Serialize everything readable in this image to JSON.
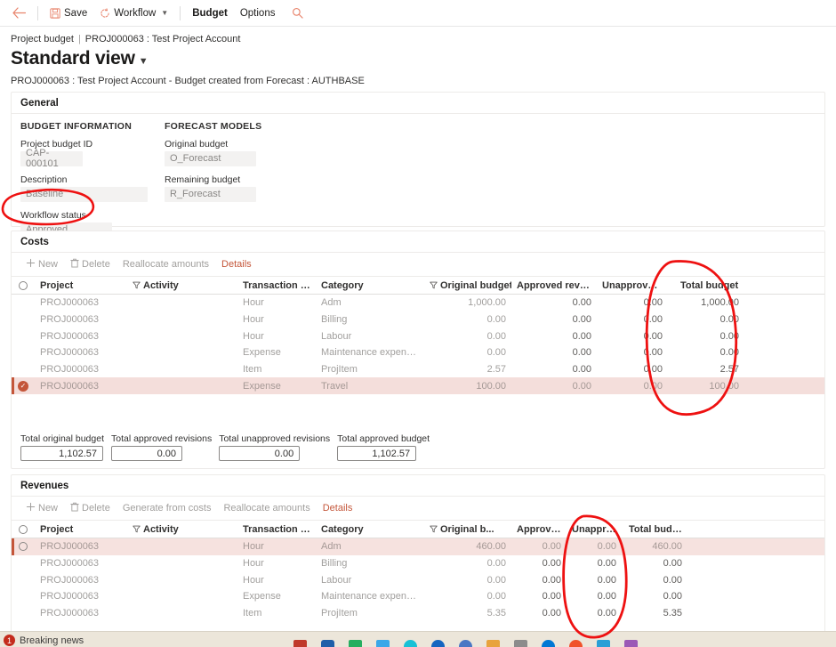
{
  "command_bar": {
    "back_icon": "back-arrow-icon",
    "items": [
      {
        "label": "Save",
        "icon": "save-disk-icon",
        "has_chevron": false,
        "bold": false
      },
      {
        "label": "Workflow",
        "icon": "workflow-circular-arrow-icon",
        "has_chevron": true,
        "bold": false
      },
      {
        "label": "Budget",
        "icon": "",
        "has_chevron": false,
        "bold": true
      },
      {
        "label": "Options",
        "icon": "",
        "has_chevron": false,
        "bold": false
      }
    ],
    "search_icon": "search-icon"
  },
  "breadcrumb": {
    "root": "Project budget",
    "separator": "|",
    "current": "PROJ000063 : Test Project Account"
  },
  "page_title": "Standard view",
  "subtitle": "PROJ000063 : Test Project Account - Budget created from Forecast : AUTHBASE",
  "general": {
    "section_title": "General",
    "budget_information": {
      "heading": "BUDGET INFORMATION",
      "fields": [
        {
          "label": "Project budget ID",
          "value": "CAP-000101"
        },
        {
          "label": "Description",
          "value": "Baseline"
        },
        {
          "label": "Workflow status",
          "value": "Approved"
        }
      ]
    },
    "forecast_models": {
      "heading": "FORECAST MODELS",
      "fields": [
        {
          "label": "Original budget",
          "value": "O_Forecast"
        },
        {
          "label": "Remaining budget",
          "value": "R_Forecast"
        }
      ]
    }
  },
  "costs": {
    "section_title": "Costs",
    "toolbar": [
      {
        "label": "New",
        "icon": "plus-icon",
        "enabled": false
      },
      {
        "label": "Delete",
        "icon": "trash-icon",
        "enabled": false
      },
      {
        "label": "Reallocate amounts",
        "icon": "",
        "enabled": false
      },
      {
        "label": "Details",
        "icon": "",
        "enabled": true
      }
    ],
    "columns": [
      "Project",
      "Activity",
      "Transaction type",
      "Category",
      "Original budget",
      "Approved revisions",
      "Unapproved re...",
      "Total budget"
    ],
    "rows": [
      {
        "selected": false,
        "project": "PROJ000063",
        "activity": "",
        "transaction_type": "Hour",
        "category": "Adm",
        "original_budget": "1,000.00",
        "approved_revisions": "0.00",
        "unapproved_revisions": "0.00",
        "total_budget": "1,000.00"
      },
      {
        "selected": false,
        "project": "PROJ000063",
        "activity": "",
        "transaction_type": "Hour",
        "category": "Billing",
        "original_budget": "0.00",
        "approved_revisions": "0.00",
        "unapproved_revisions": "0.00",
        "total_budget": "0.00"
      },
      {
        "selected": false,
        "project": "PROJ000063",
        "activity": "",
        "transaction_type": "Hour",
        "category": "Labour",
        "original_budget": "0.00",
        "approved_revisions": "0.00",
        "unapproved_revisions": "0.00",
        "total_budget": "0.00"
      },
      {
        "selected": false,
        "project": "PROJ000063",
        "activity": "",
        "transaction_type": "Expense",
        "category": "Maintenance expenses",
        "original_budget": "0.00",
        "approved_revisions": "0.00",
        "unapproved_revisions": "0.00",
        "total_budget": "0.00"
      },
      {
        "selected": false,
        "project": "PROJ000063",
        "activity": "",
        "transaction_type": "Item",
        "category": "ProjItem",
        "original_budget": "2.57",
        "approved_revisions": "0.00",
        "unapproved_revisions": "0.00",
        "total_budget": "2.57"
      },
      {
        "selected": true,
        "project": "PROJ000063",
        "activity": "",
        "transaction_type": "Expense",
        "category": "Travel",
        "original_budget": "100.00",
        "approved_revisions": "0.00",
        "unapproved_revisions": "0.00",
        "total_budget": "100.00"
      }
    ],
    "totals": [
      {
        "label": "Total original budget",
        "value": "1,102.57"
      },
      {
        "label": "Total approved revisions",
        "value": "0.00"
      },
      {
        "label": "Total unapproved revisions",
        "value": "0.00"
      },
      {
        "label": "Total approved budget",
        "value": "1,102.57"
      }
    ]
  },
  "revenues": {
    "section_title": "Revenues",
    "toolbar": [
      {
        "label": "New",
        "icon": "plus-icon",
        "enabled": false
      },
      {
        "label": "Delete",
        "icon": "trash-icon",
        "enabled": false
      },
      {
        "label": "Generate from costs",
        "icon": "",
        "enabled": false
      },
      {
        "label": "Reallocate amounts",
        "icon": "",
        "enabled": false
      },
      {
        "label": "Details",
        "icon": "",
        "enabled": true
      }
    ],
    "columns": [
      "Project",
      "Activity",
      "Transaction type",
      "Category",
      "Original b...",
      "Approved ...",
      "Unapprove...",
      "Total budget"
    ],
    "rows": [
      {
        "selected": true,
        "project": "PROJ000063",
        "activity": "",
        "transaction_type": "Hour",
        "category": "Adm",
        "original_budget": "460.00",
        "approved_revisions": "0.00",
        "unapproved_revisions": "0.00",
        "total_budget": "460.00"
      },
      {
        "selected": false,
        "project": "PROJ000063",
        "activity": "",
        "transaction_type": "Hour",
        "category": "Billing",
        "original_budget": "0.00",
        "approved_revisions": "0.00",
        "unapproved_revisions": "0.00",
        "total_budget": "0.00"
      },
      {
        "selected": false,
        "project": "PROJ000063",
        "activity": "",
        "transaction_type": "Hour",
        "category": "Labour",
        "original_budget": "0.00",
        "approved_revisions": "0.00",
        "unapproved_revisions": "0.00",
        "total_budget": "0.00"
      },
      {
        "selected": false,
        "project": "PROJ000063",
        "activity": "",
        "transaction_type": "Expense",
        "category": "Maintenance expenses",
        "original_budget": "0.00",
        "approved_revisions": "0.00",
        "unapproved_revisions": "0.00",
        "total_budget": "0.00"
      },
      {
        "selected": false,
        "project": "PROJ000063",
        "activity": "",
        "transaction_type": "Item",
        "category": "ProjItem",
        "original_budget": "5.35",
        "approved_revisions": "0.00",
        "unapproved_revisions": "0.00",
        "total_budget": "5.35"
      }
    ]
  },
  "annotations": {
    "color": "#ee1111",
    "marks": [
      {
        "name": "workflow-status-circle",
        "shape": "oval"
      },
      {
        "name": "costs-total-budget-circle",
        "shape": "oval"
      },
      {
        "name": "revenues-total-budget-circle",
        "shape": "oval"
      }
    ]
  },
  "taskbar": {
    "news_badge": "1",
    "news_label": "Breaking news"
  }
}
